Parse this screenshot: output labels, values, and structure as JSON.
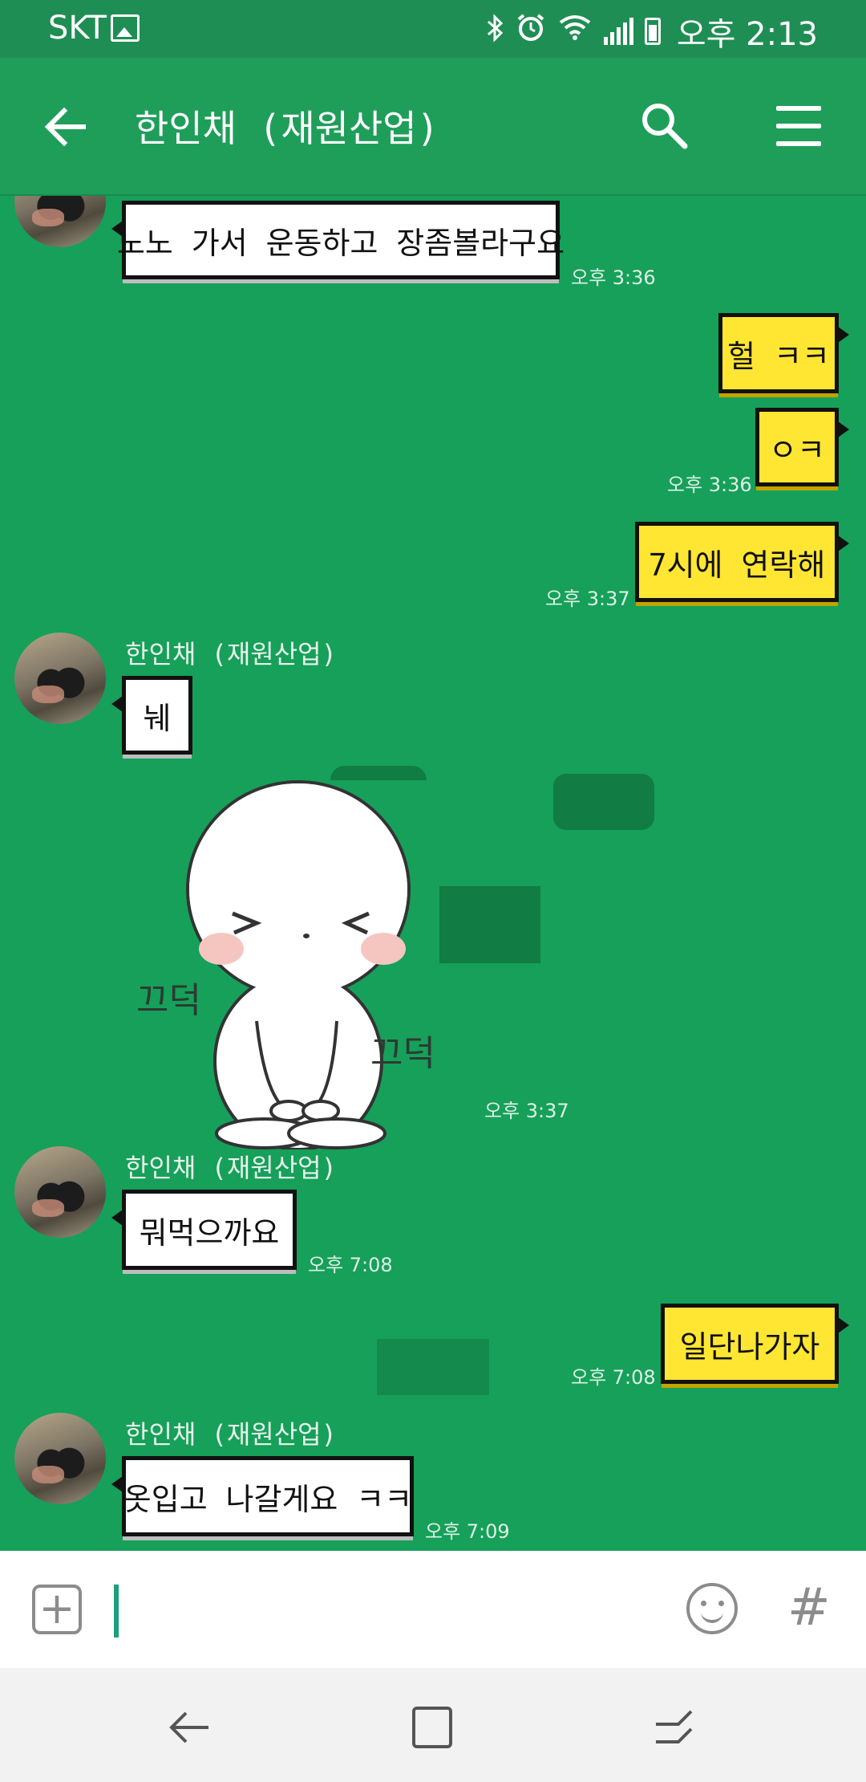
{
  "status_bar": {
    "carrier": "SKT",
    "time": "오후 2:13",
    "icons": [
      "image-icon",
      "bluetooth-icon",
      "alarm-icon",
      "wifi-icon",
      "signal-icon",
      "battery-icon"
    ]
  },
  "header": {
    "title": "한인채 (재원산업)",
    "icons": [
      "back-arrow-icon",
      "search-icon",
      "menu-icon"
    ]
  },
  "messages": [
    {
      "direction": "in",
      "sender": "",
      "text": "노노 가서 운동하고 장좀볼라구요",
      "time": "오후 3:36"
    },
    {
      "direction": "out",
      "text": "헐 ㅋㅋ",
      "time": ""
    },
    {
      "direction": "out",
      "text": "ㅇㅋ",
      "time": "오후 3:36"
    },
    {
      "direction": "out",
      "text": "7시에 연락해",
      "time": "오후 3:37"
    },
    {
      "direction": "in",
      "sender": "한인채 (재원산업)",
      "text": "눼",
      "time": ""
    },
    {
      "direction": "in",
      "type": "sticker",
      "sticker_left_text": "끄덕",
      "sticker_right_text": "끄덕",
      "time": "오후 3:37"
    },
    {
      "direction": "in",
      "sender": "한인채 (재원산업)",
      "text": "뭐먹으까요",
      "time": "오후 7:08"
    },
    {
      "direction": "out",
      "text": "일단나가자",
      "time": "오후 7:08"
    },
    {
      "direction": "in",
      "sender": "한인채 (재원산업)",
      "text": "옷입고 나갈게요 ㅋㅋ",
      "time": "오후 7:09"
    }
  ],
  "input_bar": {
    "icons": [
      "plus-icon",
      "emoji-icon",
      "hash-icon"
    ],
    "hash_label": "#",
    "plus_label": "+",
    "value": ""
  },
  "nav_bar": {
    "icons": [
      "back-nav-icon",
      "home-nav-icon",
      "recents-nav-icon"
    ]
  },
  "colors": {
    "chat_background": "#16a05a",
    "app_bar": "#1f9e5a",
    "outgoing_bubble": "#ffe632",
    "incoming_bubble": "#ffffff"
  }
}
